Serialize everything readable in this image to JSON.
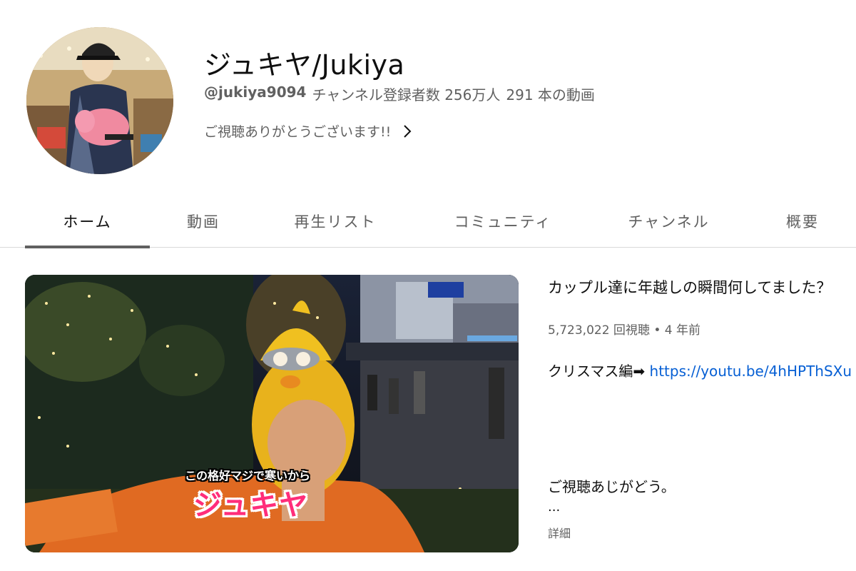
{
  "channel": {
    "name": "ジュキヤ/Jukiya",
    "handle": "@jukiya9094",
    "subscribers": "チャンネル登録者数 256万人",
    "video_count": "291 本の動画",
    "description": "ご視聴ありがとうございます!!"
  },
  "tabs": [
    {
      "label": "ホーム",
      "active": true
    },
    {
      "label": "動画"
    },
    {
      "label": "再生リスト"
    },
    {
      "label": "コミュニティ"
    },
    {
      "label": "チャンネル"
    },
    {
      "label": "概要"
    }
  ],
  "featured": {
    "thumbnail_caption_small": "この格好マジで寒いから",
    "thumbnail_caption_big": "ジュキヤ",
    "title": "カップル達に年越しの瞬間何してました？",
    "views": "5,723,022 回視聴",
    "age": "4 年前",
    "description_prefix": "クリスマス編➡ ",
    "description_link": "https://youtu.be/4hHPThSXu",
    "description_line2": "ご視聴あじがどう。",
    "ellipsis": "...",
    "more_label": "詳細"
  },
  "colors": {
    "link": "#065fd4",
    "secondary_text": "#606060",
    "caption_pink": "#ff2d7a"
  }
}
